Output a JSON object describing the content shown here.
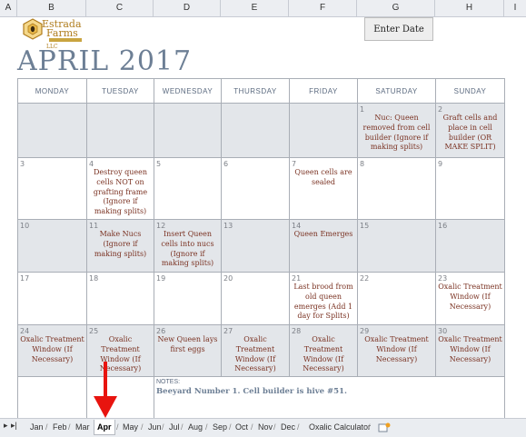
{
  "columns": [
    "A",
    "B",
    "C",
    "D",
    "E",
    "F",
    "G",
    "H",
    "I"
  ],
  "logo": {
    "line1": "Estrada",
    "line2": "Farms",
    "suffix": "LLC"
  },
  "enter_date_label": "Enter Date",
  "title": "APRIL 2017",
  "weekdays": [
    "MONDAY",
    "TUESDAY",
    "WEDNESDAY",
    "THURSDAY",
    "FRIDAY",
    "SATURDAY",
    "SUNDAY"
  ],
  "weeks": [
    [
      {
        "day": "",
        "text": ""
      },
      {
        "day": "",
        "text": ""
      },
      {
        "day": "",
        "text": ""
      },
      {
        "day": "",
        "text": ""
      },
      {
        "day": "",
        "text": ""
      },
      {
        "day": "1",
        "text": "Nuc: Queen removed from cell builder (Ignore if making splits)"
      },
      {
        "day": "2",
        "text": "Graft cells and place in cell builder (OR MAKE SPLIT)"
      }
    ],
    [
      {
        "day": "3",
        "text": ""
      },
      {
        "day": "4",
        "text": "Destroy queen cells NOT on grafting frame (Ignore if making splits)"
      },
      {
        "day": "5",
        "text": ""
      },
      {
        "day": "6",
        "text": ""
      },
      {
        "day": "7",
        "text": "Queen cells are sealed"
      },
      {
        "day": "8",
        "text": ""
      },
      {
        "day": "9",
        "text": ""
      }
    ],
    [
      {
        "day": "10",
        "text": ""
      },
      {
        "day": "11",
        "text": "Make Nucs (Ignore if making splits)"
      },
      {
        "day": "12",
        "text": "Insert Queen cells into nucs (Ignore if making splits)"
      },
      {
        "day": "13",
        "text": ""
      },
      {
        "day": "14",
        "text": "Queen Emerges"
      },
      {
        "day": "15",
        "text": ""
      },
      {
        "day": "16",
        "text": ""
      }
    ],
    [
      {
        "day": "17",
        "text": ""
      },
      {
        "day": "18",
        "text": ""
      },
      {
        "day": "19",
        "text": ""
      },
      {
        "day": "20",
        "text": ""
      },
      {
        "day": "21",
        "text": "Last brood from old queen emerges (Add 1 day for Splits)"
      },
      {
        "day": "22",
        "text": ""
      },
      {
        "day": "23",
        "text": "Oxalic Treatment Window (If Necessary)"
      }
    ],
    [
      {
        "day": "24",
        "text": "Oxalic Treatment Window (If Necessary)"
      },
      {
        "day": "25",
        "text": "Oxalic Treatment Window (If Necessary)"
      },
      {
        "day": "26",
        "text": "New Queen lays first eggs"
      },
      {
        "day": "27",
        "text": "Oxalic Treatment Window (If Necessary)"
      },
      {
        "day": "28",
        "text": "Oxalic Treatment Window (If Necessary)"
      },
      {
        "day": "29",
        "text": "Oxalic Treatment Window (If Necessary)"
      },
      {
        "day": "30",
        "text": "Oxalic Treatment Window (If Necessary)"
      }
    ]
  ],
  "notes": {
    "label": "NOTES:",
    "text": "Beeyard Number 1. Cell builder is hive #51."
  },
  "tabs": [
    "Jan",
    "Feb",
    "Mar",
    "Apr",
    "May",
    "Jun",
    "Jul",
    "Aug",
    "Sep",
    "Oct",
    "Nov",
    "Dec",
    "Oxalic Calculator"
  ],
  "active_tab": "Apr",
  "colors": {
    "title": "#6d7f95",
    "event_text": "#7a3222",
    "shaded_row": "#e3e6ea",
    "arrow": "#e8140f"
  }
}
